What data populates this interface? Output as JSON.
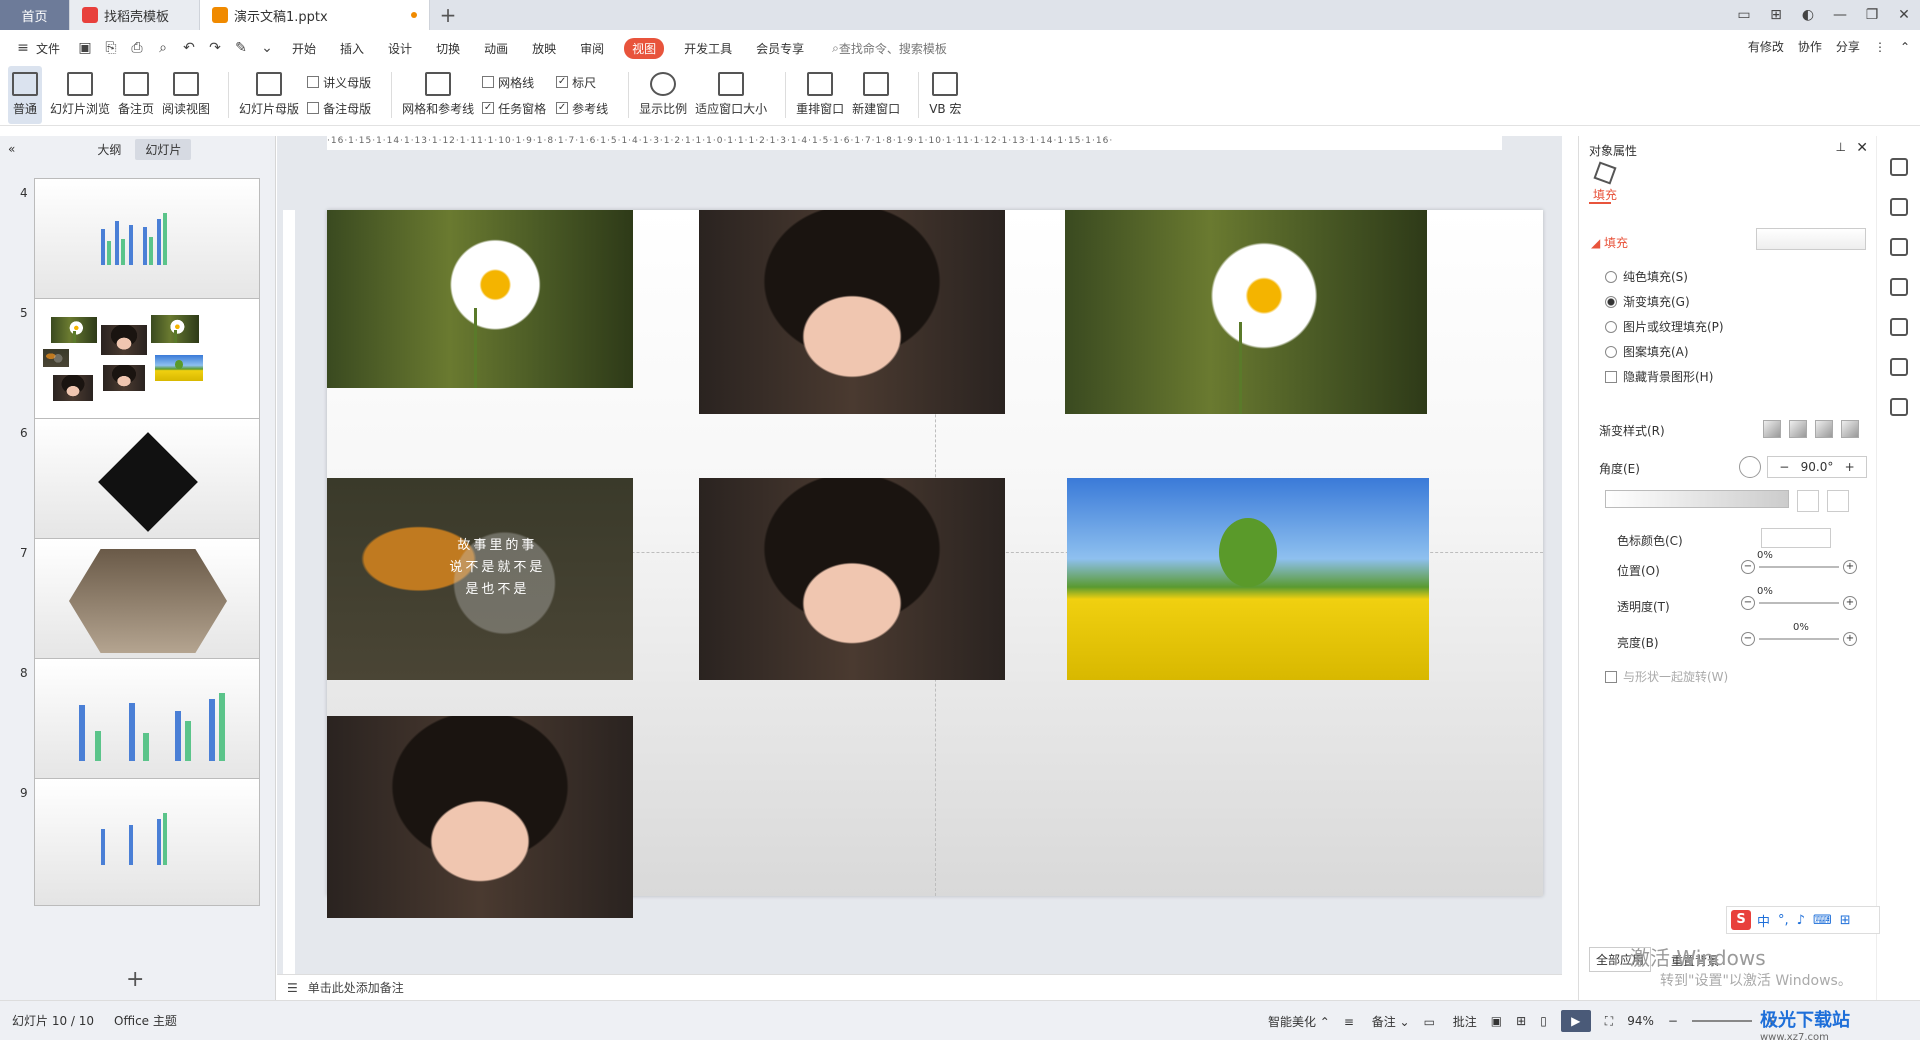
{
  "tabs": [
    {
      "label": "首页"
    },
    {
      "label": "找稻壳模板"
    },
    {
      "label": "演示文稿1.pptx"
    }
  ],
  "menu": {
    "file": "文件",
    "items": [
      "开始",
      "插入",
      "设计",
      "切换",
      "动画",
      "放映",
      "审阅",
      "视图",
      "开发工具",
      "会员专享"
    ],
    "active": "视图",
    "search_placeholder": "查找命令、搜索模板",
    "right": [
      "有修改",
      "协作",
      "分享"
    ]
  },
  "ribbon": {
    "normal": "普通",
    "slide_sorter": "幻灯片浏览",
    "notes_page": "备注页",
    "reading_view": "阅读视图",
    "slide_master": "幻灯片母版",
    "handout_master": "讲义母版",
    "notes_master": "备注母版",
    "grid_guides": "网格和参考线",
    "gridlines": "网格线",
    "task_pane": "任务窗格",
    "ruler": "标尺",
    "guides": "参考线",
    "zoom": "显示比例",
    "fit_window": "适应窗口大小",
    "arrange": "重排窗口",
    "new_window": "新建窗口",
    "vb_macro": "VB 宏"
  },
  "left_pane": {
    "tab_outline": "大纲",
    "tab_slides": "幻灯片",
    "slide_numbers": [
      "4",
      "5",
      "6",
      "7",
      "8",
      "9"
    ]
  },
  "slide": {
    "autumn_text": [
      "故事里的事",
      "说不是就不是",
      "是也不是"
    ]
  },
  "notes_placeholder": "单击此处添加备注",
  "ruler_text": "·16·1·15·1·14·1·13·1·12·1·11·1·10·1·9·1·8·1·7·1·6·1·5·1·4·1·3·1·2·1·1·1·0·1·1·1·2·1·3·1·4·1·5·1·6·1·7·1·8·1·9·1·10·1·11·1·12·1·13·1·14·1·15·1·16·",
  "right_pane": {
    "title": "对象属性",
    "fill_tab": "填充",
    "section": "填充",
    "options": [
      "纯色填充(S)",
      "渐变填充(G)",
      "图片或纹理填充(P)",
      "图案填充(A)"
    ],
    "hide_bg": "隐藏背景图形(H)",
    "gradient_style": "渐变样式(R)",
    "angle_label": "角度(E)",
    "angle_value": "90.0°",
    "stop_color": "色标颜色(C)",
    "position": "位置(O)",
    "position_value": "0%",
    "transparency": "透明度(T)",
    "transparency_value": "0%",
    "brightness": "亮度(B)",
    "brightness_value": "0%",
    "rotate_with_shape": "与形状一起旋转(W)",
    "apply_all": "全部应用",
    "reset_bg": "重置背景"
  },
  "status": {
    "slide_index": "幻灯片 10 / 10",
    "theme": "Office 主题",
    "smart_beautify": "智能美化",
    "notes": "备注",
    "comments": "批注",
    "zoom": "94%"
  },
  "watermark": {
    "line1": "激活 Windows",
    "line2": "转到\"设置\"以激活 Windows。"
  },
  "ime_label": "中",
  "site_logo": {
    "name": "极光下载站",
    "url_text": "www.xz7.com"
  },
  "colors": {
    "accent": "#e8543c",
    "tabbar": "#dfe3ea",
    "pane": "#eef0f4"
  }
}
